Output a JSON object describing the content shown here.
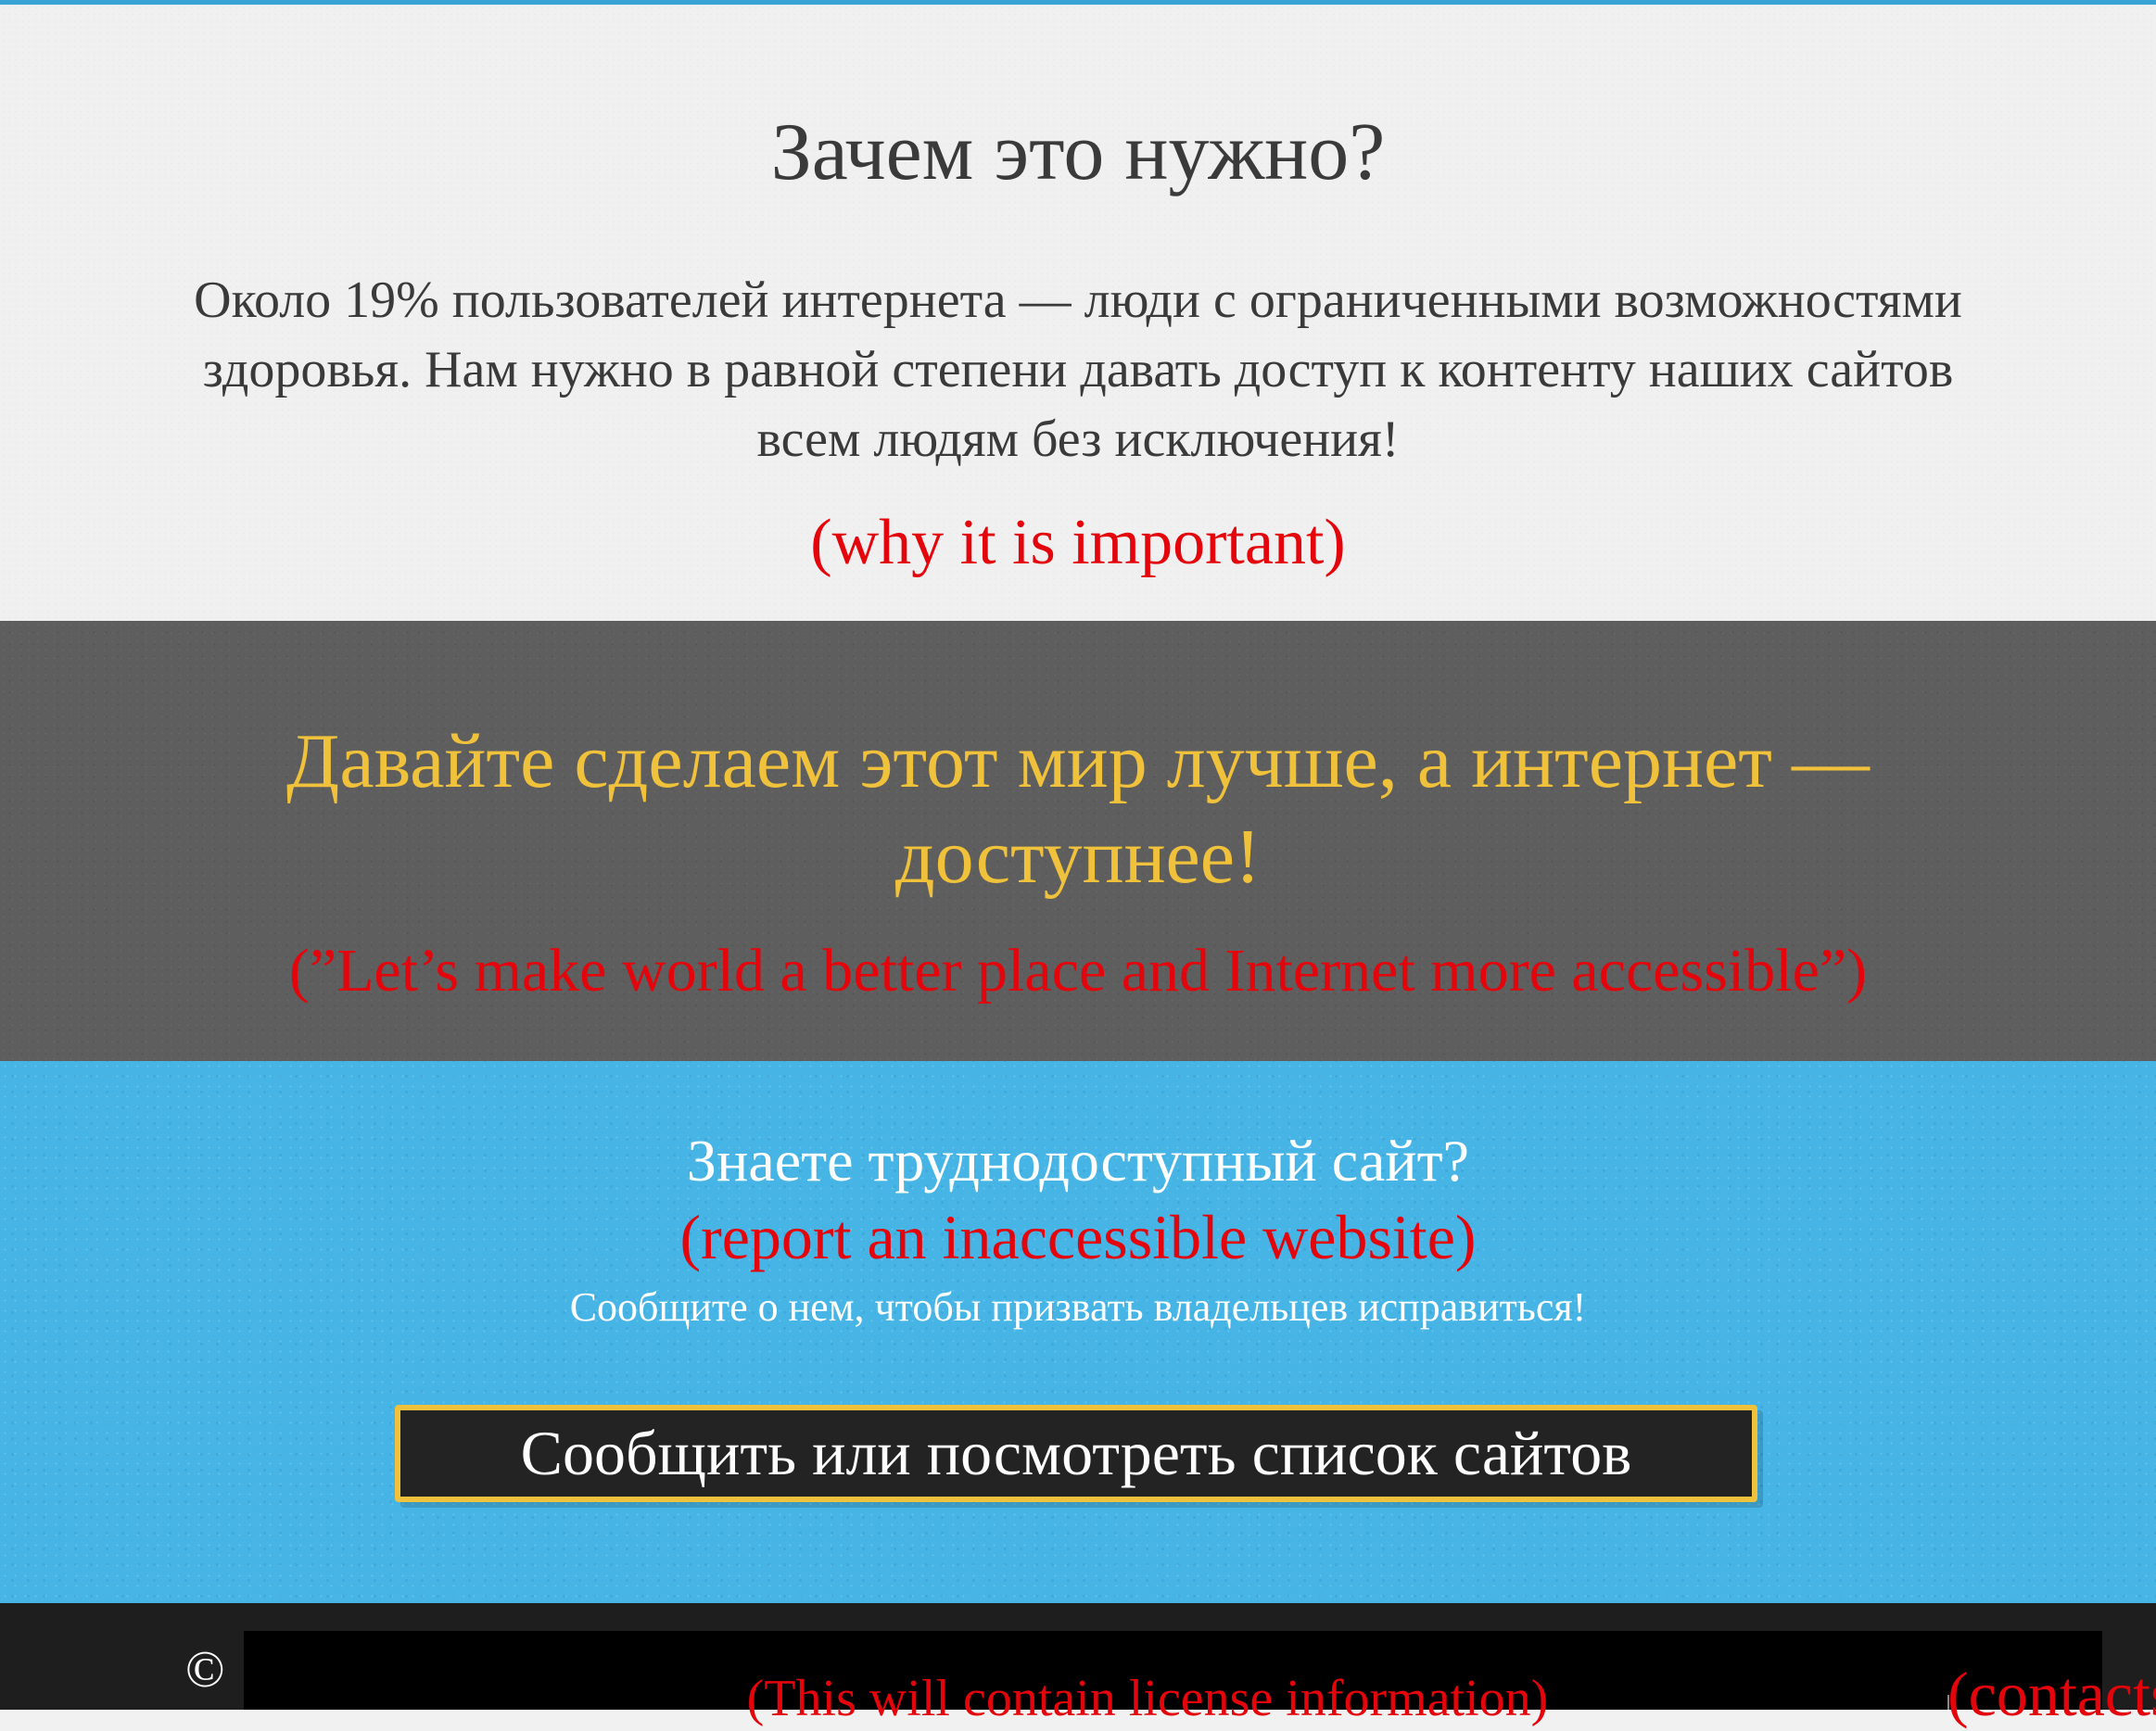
{
  "why_section": {
    "title": "Зачем это нужно?",
    "body": "Около 19% пользователей интернета — люди с ограниченными возможностями здоровья. Нам нужно в равной степени давать доступ к контенту наших сайтов всем людям без исключения!",
    "annotation": "(why it is important)"
  },
  "cta_section": {
    "title": "Давайте сделаем этот мир лучше, а интернет — доступнее!",
    "annotation": "(”Let’s make world a better place and Internet more accessible”)"
  },
  "report_section": {
    "title": "Знаете труднодоступный сайт?",
    "annotation": "(report an inaccessible website)",
    "subtitle": "Сообщите о нем, чтобы призвать владельцев исправиться!",
    "button_label": "Сообщить или посмотреть список сайтов"
  },
  "footer": {
    "copyright_symbol": "©",
    "license_text": "(This will contain license information)",
    "contacts_label": "(contacts)"
  },
  "colors": {
    "annotation_red": "#e4040b",
    "accent_yellow": "#f0c13a",
    "section_gray": "#5e5e5e",
    "section_blue": "#46b5e6",
    "footer_dark": "#1e1e1e"
  }
}
